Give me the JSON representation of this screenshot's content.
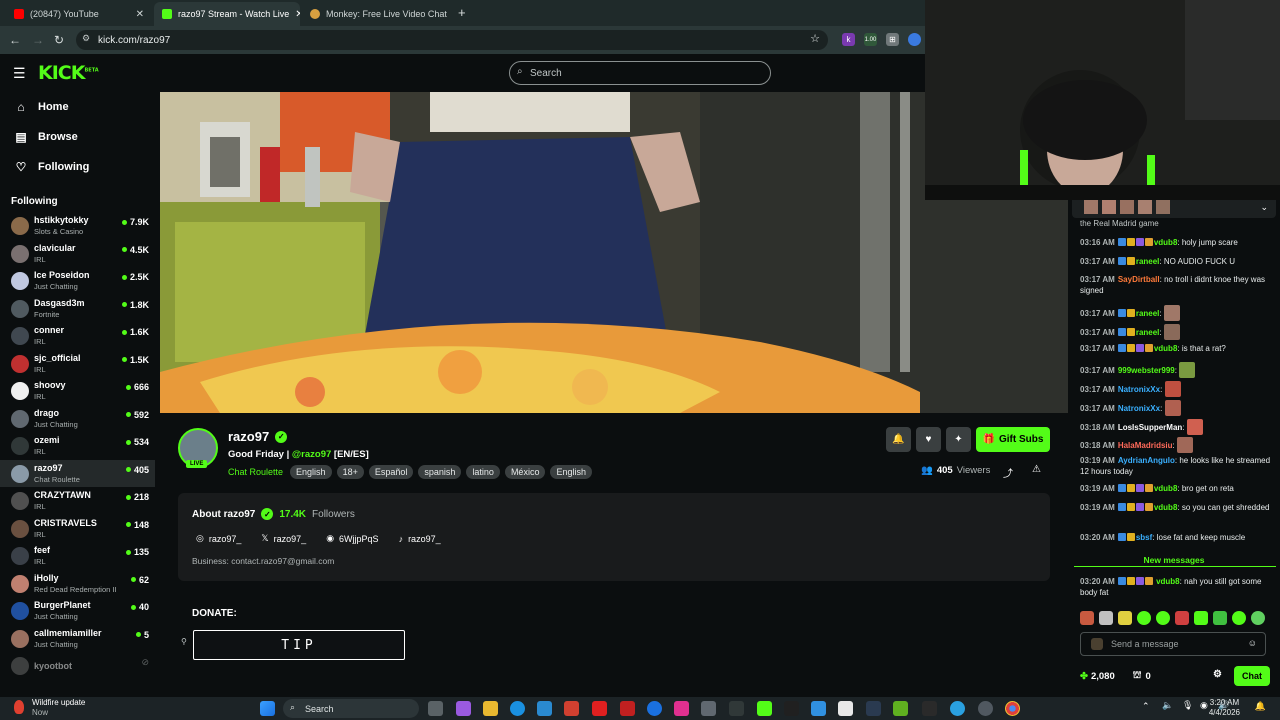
{
  "browser": {
    "tabs": [
      {
        "label": "(20847) YouTube",
        "color": "#ff0000"
      },
      {
        "label": "razo97 Stream - Watch Live",
        "color": "#53fc18"
      },
      {
        "label": "Monkey: Free Live Video Chat",
        "color": "#d8a040"
      }
    ],
    "url": "kick.com/razo97"
  },
  "header": {
    "logo": "KICK",
    "logo_sup": "BETA",
    "search_placeholder": "Search"
  },
  "sidebar": {
    "nav": [
      {
        "label": "Home",
        "icon": "home-icon"
      },
      {
        "label": "Browse",
        "icon": "browse-icon"
      },
      {
        "label": "Following",
        "icon": "heart-icon"
      }
    ],
    "following_heading": "Following",
    "channels": [
      {
        "name": "hstikkytokky",
        "category": "Slots & Casino",
        "viewers": "7.9K",
        "color": "#8a6a4a"
      },
      {
        "name": "clavicular",
        "category": "IRL",
        "viewers": "4.5K",
        "color": "#7a7070"
      },
      {
        "name": "Ice Poseidon",
        "category": "Just Chatting",
        "viewers": "2.5K",
        "color": "#c0c8e0"
      },
      {
        "name": "Dasgasd3m",
        "category": "Fortnite",
        "viewers": "1.8K",
        "color": "#505a60"
      },
      {
        "name": "conner",
        "category": "IRL",
        "viewers": "1.6K",
        "color": "#404850"
      },
      {
        "name": "sjc_official",
        "category": "IRL",
        "viewers": "1.5K",
        "color": "#c03030"
      },
      {
        "name": "shoovy",
        "category": "IRL",
        "viewers": "666",
        "color": "#f0f0f0"
      },
      {
        "name": "drago",
        "category": "Just Chatting",
        "viewers": "592",
        "color": "#606870"
      },
      {
        "name": "ozemi",
        "category": "IRL",
        "viewers": "534",
        "color": "#303838"
      },
      {
        "name": "razo97",
        "category": "Chat Roulette",
        "viewers": "405",
        "color": "#8a9aa8",
        "selected": true
      },
      {
        "name": "CRAZYTAWN",
        "category": "IRL",
        "viewers": "218",
        "color": "#505050"
      },
      {
        "name": "CRISTRAVELS",
        "category": "IRL",
        "viewers": "148",
        "color": "#6a5040"
      },
      {
        "name": "feef",
        "category": "IRL",
        "viewers": "135",
        "color": "#3a4048"
      },
      {
        "name": "iHolly",
        "category": "Red Dead Redemption II",
        "viewers": "62",
        "color": "#c08070"
      },
      {
        "name": "BurgerPlanet",
        "category": "Just Chatting",
        "viewers": "40",
        "color": "#2050a0"
      },
      {
        "name": "callmemiamiller",
        "category": "Just Chatting",
        "viewers": "5",
        "color": "#9a7060"
      },
      {
        "name": "kyootbot",
        "category": "",
        "viewers": "",
        "color": "#707070",
        "offline": true
      }
    ]
  },
  "channel": {
    "name": "razo97",
    "live_label": "LIVE",
    "title_prefix": "Good Friday | ",
    "title_handle": "@razo97",
    "title_suffix": " [EN/ES]",
    "category": "Chat Roulette",
    "tags": [
      "English",
      "18+",
      "Español",
      "spanish",
      "latino",
      "México",
      "English"
    ],
    "gift_subs_label": "Gift Subs",
    "viewers_count": "405",
    "viewers_label": "Viewers"
  },
  "about": {
    "heading": "About razo97",
    "followers_count": "17.4K",
    "followers_label": "Followers",
    "socials": [
      {
        "icon": "instagram-icon",
        "label": "razo97_"
      },
      {
        "icon": "x-icon",
        "label": "razo97_"
      },
      {
        "icon": "discord-icon",
        "label": "6WjjpPqS"
      },
      {
        "icon": "tiktok-icon",
        "label": "razo97_"
      }
    ],
    "business": "Business: contact.razo97@gmail.com"
  },
  "donate": {
    "heading": "DONATE:",
    "tip_label": "TIP"
  },
  "chat": {
    "partial_top": "the Real Madrid game",
    "messages": [
      {
        "time": "03:16 AM",
        "user": "vdub8",
        "color": "#53fc18",
        "text": "holy jump scare"
      },
      {
        "time": "03:17 AM",
        "user": "raneel",
        "color": "#53fc18",
        "text": "NO AUDIO FUCK U"
      },
      {
        "time": "03:17 AM",
        "user": "SayDirtball",
        "color": "#ff7a3a",
        "text": "no troll i didnt knoe they was signed"
      },
      {
        "time": "03:17 AM",
        "user": "raneel",
        "color": "#53fc18",
        "text": ""
      },
      {
        "time": "03:17 AM",
        "user": "raneel",
        "color": "#53fc18",
        "text": ""
      },
      {
        "time": "03:17 AM",
        "user": "vdub8",
        "color": "#53fc18",
        "text": "is that a rat?"
      },
      {
        "time": "03:17 AM",
        "user": "999webster999",
        "color": "#53fc18",
        "text": ""
      },
      {
        "time": "03:17 AM",
        "user": "NatronixXx",
        "color": "#3ab0ff",
        "text": ""
      },
      {
        "time": "03:17 AM",
        "user": "NatronixXx",
        "color": "#3ab0ff",
        "text": ""
      },
      {
        "time": "03:18 AM",
        "user": "LosIsSupperMan",
        "color": "#ffffff",
        "text": ""
      },
      {
        "time": "03:18 AM",
        "user": "HalaMadridsiu",
        "color": "#ff6a5a",
        "text": ""
      },
      {
        "time": "03:19 AM",
        "user": "AydrianAngulo",
        "color": "#3ab0ff",
        "text": "he looks like he streamed 12 hours today"
      },
      {
        "time": "03:19 AM",
        "user": "vdub8",
        "color": "#53fc18",
        "text": "bro get on reta"
      },
      {
        "time": "03:19 AM",
        "user": "vdub8",
        "color": "#53fc18",
        "text": "so you can get shredded"
      },
      {
        "time": "03:20 AM",
        "user": "sbsf",
        "color": "#3ab0ff",
        "text": "lose fat and keep muscle"
      }
    ],
    "new_messages_label": "New messages",
    "last_message": {
      "time": "03:20 AM",
      "user": "vdub8",
      "color": "#53fc18",
      "text": "nah you still got some body fat"
    },
    "input_placeholder": "Send a message",
    "points": "2,080",
    "gift_count": "0",
    "chat_button": "Chat"
  },
  "taskbar": {
    "weather_title": "Wildfire update",
    "weather_sub": "Now",
    "search": "Search",
    "time": "3:20 AM",
    "date": "4/4/2026"
  }
}
